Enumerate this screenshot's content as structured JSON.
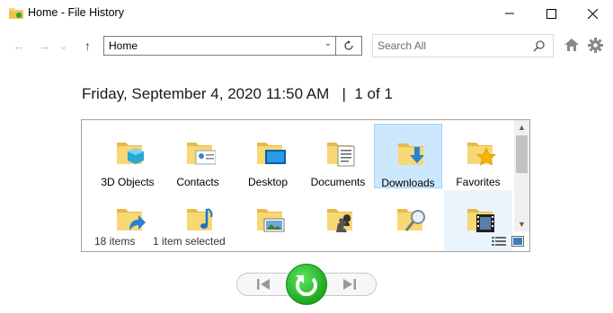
{
  "window": {
    "title": "Home - File History",
    "minimize_glyph": "—",
    "maximize_glyph": "☐",
    "close_glyph": "✕"
  },
  "navigation": {
    "back_glyph": "←",
    "forward_glyph": "→",
    "history_glyph": "⌄",
    "up_glyph": "↑",
    "address": "Home",
    "address_dropdown_glyph": "⌄",
    "search_placeholder": "Search All"
  },
  "snapshot": {
    "date": "Friday, September 4, 2020 11:50 AM",
    "separator": "|",
    "position": "1 of 1"
  },
  "items": [
    {
      "label": "3D Objects",
      "icon": "3d-objects-folder-icon",
      "selected": false
    },
    {
      "label": "Contacts",
      "icon": "contacts-folder-icon",
      "selected": false
    },
    {
      "label": "Desktop",
      "icon": "desktop-folder-icon",
      "selected": false
    },
    {
      "label": "Documents",
      "icon": "documents-folder-icon",
      "selected": false
    },
    {
      "label": "Downloads",
      "icon": "downloads-folder-icon",
      "selected": true
    },
    {
      "label": "Favorites",
      "icon": "favorites-folder-icon",
      "selected": false
    },
    {
      "label": "",
      "icon": "links-folder-icon",
      "selected": false
    },
    {
      "label": "",
      "icon": "music-folder-icon",
      "selected": false
    },
    {
      "label": "",
      "icon": "pictures-folder-icon",
      "selected": false
    },
    {
      "label": "",
      "icon": "saved-games-folder-icon",
      "selected": false
    },
    {
      "label": "",
      "icon": "searches-folder-icon",
      "selected": false
    },
    {
      "label": "",
      "icon": "videos-folder-icon",
      "selected": false
    }
  ],
  "status": {
    "item_count": "18 items",
    "selection": "1 item selected"
  },
  "colors": {
    "folder": "#f8d775",
    "folder_dark": "#e8b84a",
    "selection_bg": "#cce8ff",
    "restore_green": "#1ea81e"
  }
}
